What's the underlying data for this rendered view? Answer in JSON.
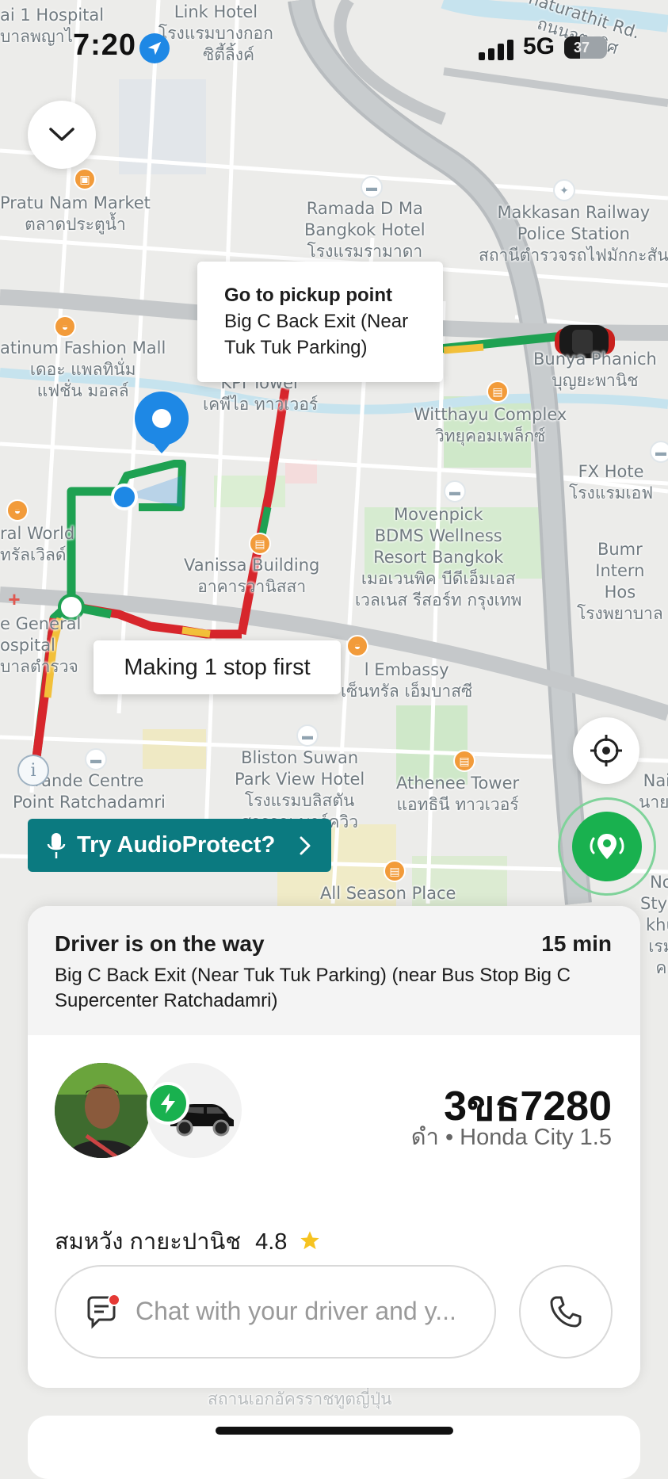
{
  "status_bar": {
    "time": "7:20",
    "network": "5G",
    "battery": "37",
    "battery_level": 0.37
  },
  "map": {
    "labels": [
      {
        "text": "ai 1 Hospital",
        "sub": "บาลพญาไ"
      },
      {
        "text": "Link Hotel",
        "sub": "โรงแรมบางกอก"
      },
      {
        "text": "ซิตี้ลิ้งค์"
      },
      {
        "text": "haturathit Rd.",
        "sub": "ถนนจตุรทิศ"
      },
      {
        "text": "Pratu Nam Market",
        "sub": "ตลาดประตูน้ำ"
      },
      {
        "text": "Ramada D Ma",
        "sub": "Bangkok Hotel",
        "sub2": "โรงแรมรามาดา"
      },
      {
        "text": "Makkasan Railway",
        "sub": "Police Station",
        "sub2": "สถานีตำรวจรถไฟมักกะสัน"
      },
      {
        "text": "atinum Fashion Mall",
        "sub": "เดอะ แพลทินั่ม",
        "sub2": "แฟชั่น มอลล์"
      },
      {
        "text": "KPI Tower",
        "sub": "เคพีไอ ทาวเวอร์"
      },
      {
        "text": "Bunya Phanich",
        "sub": "บุญยะพานิช"
      },
      {
        "text": "Witthayu Complex",
        "sub": "วิทยุคอมเพล็กซ์"
      },
      {
        "text": "FX Hote",
        "sub": "โรงแรมเอฟ"
      },
      {
        "text": "Movenpick",
        "sub": "BDMS Wellness",
        "sub2": "Resort Bangkok",
        "sub3": "เมอเวนพิค บีดีเอ็มเอส",
        "sub4": "เวลเนส รีสอร์ท กรุงเทพ"
      },
      {
        "text": "ral World",
        "sub": "ทรัลเวิลด์"
      },
      {
        "text": "Vanissa Building",
        "sub": "อาคารวานิสสา"
      },
      {
        "text": "Bumr",
        "sub": "Intern",
        "sub2": "Hos",
        "sub3": "โรงพยาบาล"
      },
      {
        "text": "e General",
        "sub": "ospital",
        "sub2": "บาลตำรวจ"
      },
      {
        "text": "l Embassy",
        "sub": "เซ็นทรัล เอ็มบาสซี"
      },
      {
        "text": "Bliston Suwan",
        "sub": "Park View Hotel",
        "sub2": "โรงแรมบลิสตัน",
        "sub3": "สุวรรณ พาร์ควิว"
      },
      {
        "text": "Athenee Tower",
        "sub": "แอทธินี ทาวเวอร์"
      },
      {
        "text": "rande Centre",
        "sub": "Point Ratchadamri"
      },
      {
        "text": "Nai",
        "sub": "นายเ"
      },
      {
        "text": "All Season Place"
      },
      {
        "text": "No",
        "sub": "Style",
        "sub2": "khu",
        "sub3": "เรม",
        "sub4": "ค"
      },
      {
        "text": "สถานเอกอัครราชทูตญี่ปุ่น"
      }
    ]
  },
  "pickup_callout": {
    "heading": "Go to pickup point",
    "body": "Big C Back Exit (Near Tuk Tuk Parking)"
  },
  "stop_callout": {
    "text": "Making 1 stop first"
  },
  "audio_protect": {
    "label": "Try AudioProtect?"
  },
  "trip_card": {
    "status": "Driver is on the way",
    "eta": "15 min",
    "address": "Big C Back Exit (Near Tuk Tuk Parking) (near Bus Stop Big C Supercenter  Ratchadamri)",
    "plate": "3ขธ7280",
    "car": "ดำ • Honda City 1.5",
    "driver_name": "สมหวัง กายะปานิช",
    "rating": "4.8",
    "chat_placeholder": "Chat with your driver and y..."
  },
  "colors": {
    "route_green": "#1ea152",
    "route_red": "#d7262c",
    "route_yellow": "#f2c03a",
    "teal": "#0b7a80",
    "grab_green": "#19b14f",
    "pin_blue": "#1e88e5"
  },
  "icons": [
    "chevron-down-icon",
    "location-arrow-icon",
    "signal-bars-icon",
    "battery-icon",
    "microphone-icon",
    "chevron-right-icon",
    "locate-icon",
    "safety-center-icon",
    "info-icon",
    "chat-bubble-icon",
    "phone-icon",
    "star-icon",
    "lightning-icon",
    "car-icon"
  ]
}
